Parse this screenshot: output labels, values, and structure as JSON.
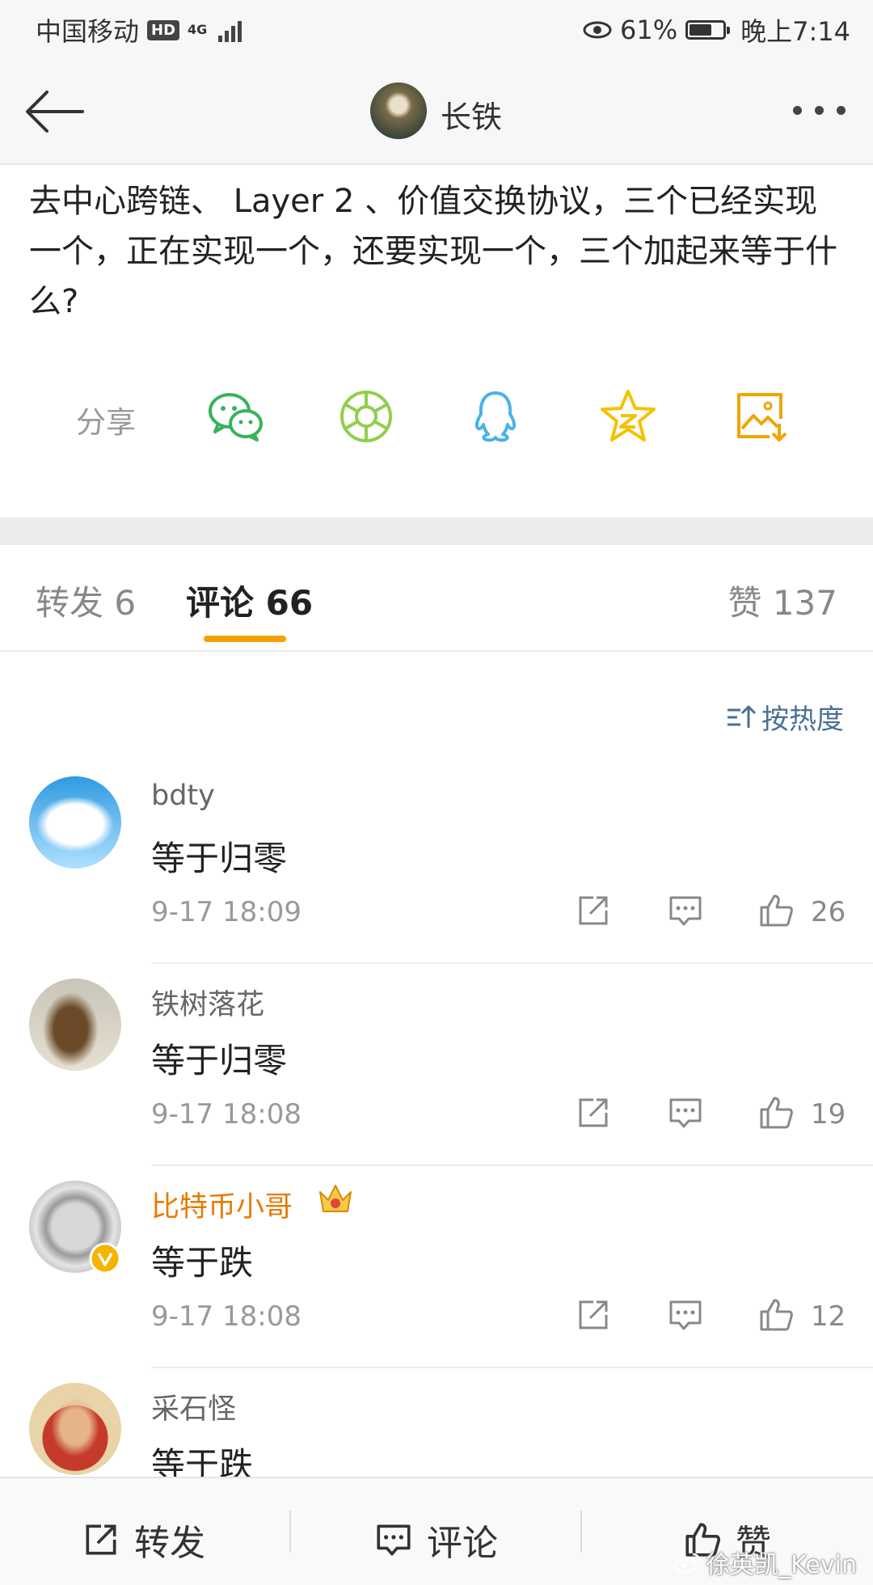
{
  "status_bar": {
    "carrier": "中国移动",
    "hd_badge": "HD",
    "network": "4G",
    "battery_pct": "61%",
    "time": "晚上7:14"
  },
  "nav": {
    "title": "长铁"
  },
  "post": {
    "text": "去中心跨链、 Layer 2 、价值交换协议，三个已经实现一个，正在实现一个，还要实现一个，三个加起来等于什么?"
  },
  "share": {
    "label": "分享",
    "targets": [
      "wechat-icon",
      "moments-icon",
      "qq-icon",
      "qzone-icon",
      "save-image-icon"
    ]
  },
  "tabs": {
    "repost": "转发 6",
    "comments": "评论 66",
    "likes": "赞 137"
  },
  "sort_label": "按热度",
  "comments": [
    {
      "name": "bdty",
      "text": "等于归零",
      "time": "9-17 18:09",
      "likes": "26",
      "vip": false
    },
    {
      "name": "铁树落花",
      "text": "等于归零",
      "time": "9-17 18:08",
      "likes": "19",
      "vip": false
    },
    {
      "name": "比特币小哥",
      "text": "等于跌",
      "time": "9-17 18:08",
      "likes": "12",
      "vip": true
    },
    {
      "name": "采石怪",
      "text": "等于跌",
      "time": "",
      "likes": "",
      "vip": false
    }
  ],
  "bottom_bar": {
    "repost": "转发",
    "comment": "评论",
    "like": "赞"
  },
  "watermark": "徐英凯_Kevin",
  "colors": {
    "accent": "#f5a00a",
    "link": "#4a6f95",
    "vip_name": "#e87a00"
  }
}
